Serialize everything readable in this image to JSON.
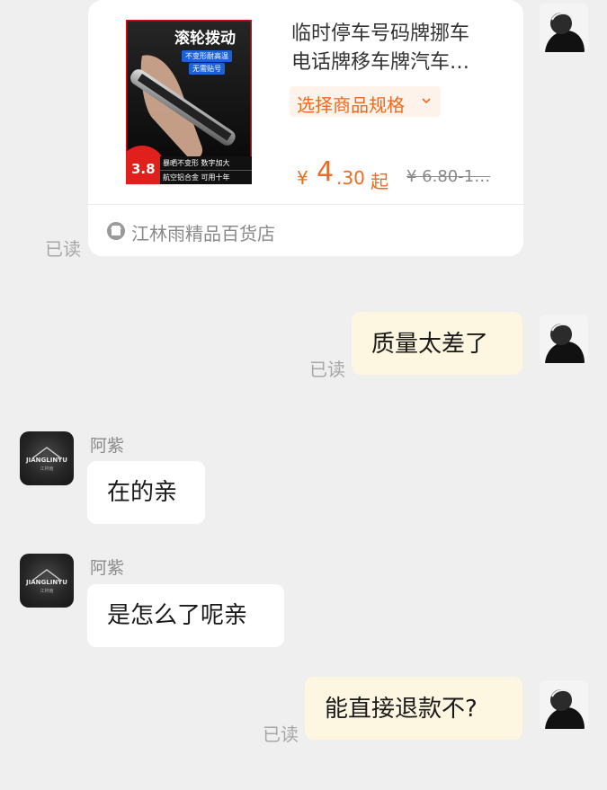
{
  "colors": {
    "accent": "#f06a1e",
    "self_bubble": "#fdf6e0",
    "background": "#efefef"
  },
  "product_card": {
    "thumbnail": {
      "banner": "滚轮拨动",
      "tag1": "不变形耐高温",
      "tag2": "无需贴号",
      "price_badge": "3.8",
      "line1": "暴晒不变形 数字加大",
      "line2": "航空铝合金 可用十年"
    },
    "title_line1": "临时停车号码牌挪车",
    "title_line2": "电话牌移车牌汽车…",
    "spec_label": "选择商品规格",
    "price_currency": "¥",
    "price_main": "4",
    "price_decimal": ".30",
    "price_suffix": "起",
    "price_original": "¥ 6.80-1…",
    "shop_name": "江林雨精品百货店",
    "read_status": "已读"
  },
  "messages": [
    {
      "side": "right",
      "text": "质量太差了",
      "read_status": "已读"
    },
    {
      "side": "left",
      "sender": "阿紫",
      "text": "在的亲"
    },
    {
      "side": "left",
      "sender": "阿紫",
      "text": "是怎么了呢亲"
    },
    {
      "side": "right",
      "text": "能直接退款不?",
      "read_status": "已读"
    }
  ],
  "shop_avatar_text": {
    "main": "JIANGLINYU",
    "sub": "江林雨"
  },
  "icons": {
    "store": "store-icon",
    "chevron": "chevron-down-icon",
    "avatar": "avatar"
  }
}
